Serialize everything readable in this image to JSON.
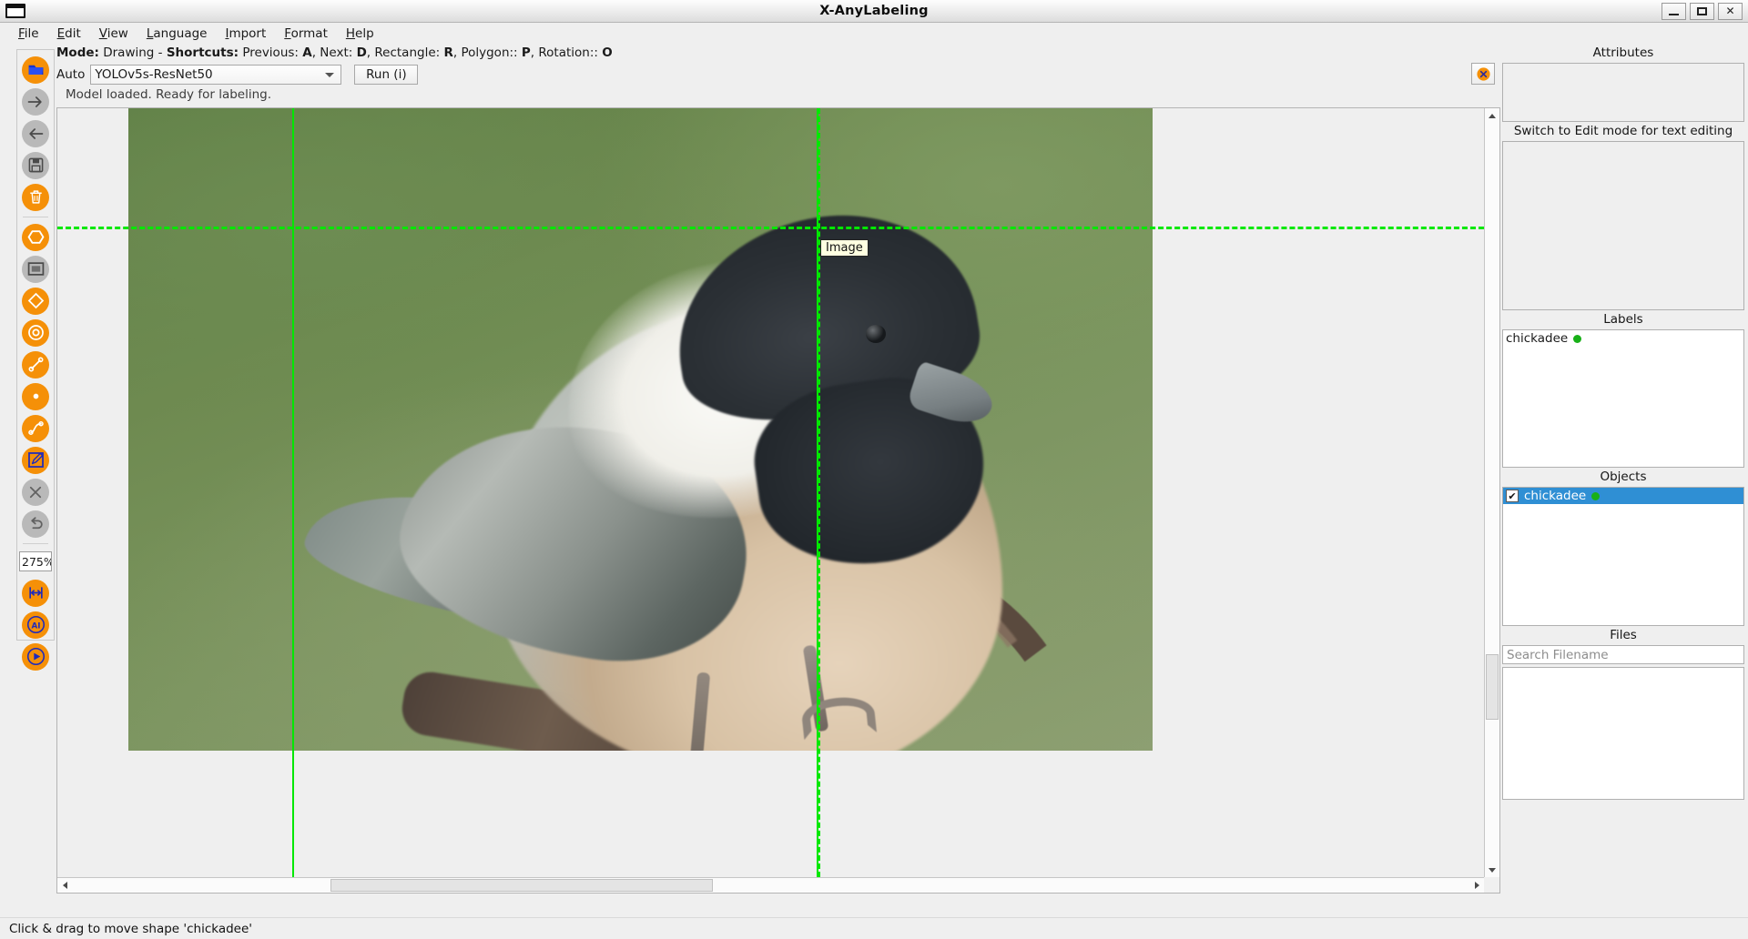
{
  "window": {
    "title": "X-AnyLabeling",
    "app_icon": "window-icon",
    "minimize": "_",
    "maximize": "□",
    "close": "✕"
  },
  "menubar": {
    "items": [
      {
        "label": "File"
      },
      {
        "label": "Edit"
      },
      {
        "label": "View"
      },
      {
        "label": "Language"
      },
      {
        "label": "Import"
      },
      {
        "label": "Format"
      },
      {
        "label": "Help"
      }
    ]
  },
  "toolbar": {
    "buttons": [
      {
        "name": "open-folder-icon",
        "state": "enabled"
      },
      {
        "name": "next-image-icon",
        "state": "disabled"
      },
      {
        "name": "prev-image-icon",
        "state": "disabled"
      },
      {
        "name": "save-icon",
        "state": "disabled"
      },
      {
        "name": "delete-icon",
        "state": "enabled"
      },
      {
        "name": "polygon-icon",
        "state": "enabled"
      },
      {
        "name": "rectangle-icon",
        "state": "disabled"
      },
      {
        "name": "rotation-icon",
        "state": "enabled"
      },
      {
        "name": "circle-icon",
        "state": "enabled"
      },
      {
        "name": "line-icon",
        "state": "enabled"
      },
      {
        "name": "point-icon",
        "state": "enabled"
      },
      {
        "name": "linestrip-icon",
        "state": "enabled"
      },
      {
        "name": "edit-shape-icon",
        "state": "enabled"
      },
      {
        "name": "cancel-icon",
        "state": "disabled"
      },
      {
        "name": "undo-icon",
        "state": "disabled"
      }
    ],
    "zoom_value": "275%",
    "bottom_buttons": [
      {
        "name": "fit-width-icon",
        "state": "enabled"
      },
      {
        "name": "ai-icon",
        "state": "enabled"
      },
      {
        "name": "run-icon",
        "state": "enabled"
      }
    ]
  },
  "mode_line": {
    "mode_key": "Mode:",
    "mode_value": " Drawing - ",
    "shortcuts_key": "Shortcuts:",
    "shortcuts_text": " Previous: ",
    "keys": [
      {
        "key": "A",
        "sep": ", Next: "
      },
      {
        "key": "D",
        "sep": ", Rectangle: "
      },
      {
        "key": "R",
        "sep": ", Polygon:: "
      },
      {
        "key": "P",
        "sep": ", Rotation:: "
      },
      {
        "key": "O",
        "sep": ""
      }
    ]
  },
  "auto_bar": {
    "label": "Auto",
    "model_selected": "YOLOv5s-ResNet50",
    "run_button": "Run (i)",
    "stop_button_icon": "stop-icon",
    "status": "Model loaded. Ready for labeling."
  },
  "canvas": {
    "tooltip_label": "Image",
    "annotation_color": "#00e800",
    "shape_name": "chickadee"
  },
  "right_panel": {
    "attributes_title": "Attributes",
    "edit_hint": "Switch to Edit mode for text editing",
    "labels_title": "Labels",
    "labels": [
      {
        "name": "chickadee",
        "color": "#18b018"
      }
    ],
    "objects_title": "Objects",
    "objects": [
      {
        "name": "chickadee",
        "color": "#18b018",
        "checked": true,
        "selected": true
      }
    ],
    "files_title": "Files",
    "files_search_placeholder": "Search Filename",
    "files": []
  },
  "status_bar": {
    "message": "Click & drag to move shape 'chickadee'"
  },
  "colors": {
    "accent_orange": "#f59008",
    "selection_blue": "#2f8fd4",
    "annotation_green": "#00e800",
    "arrow_orange": "#f5821f"
  }
}
